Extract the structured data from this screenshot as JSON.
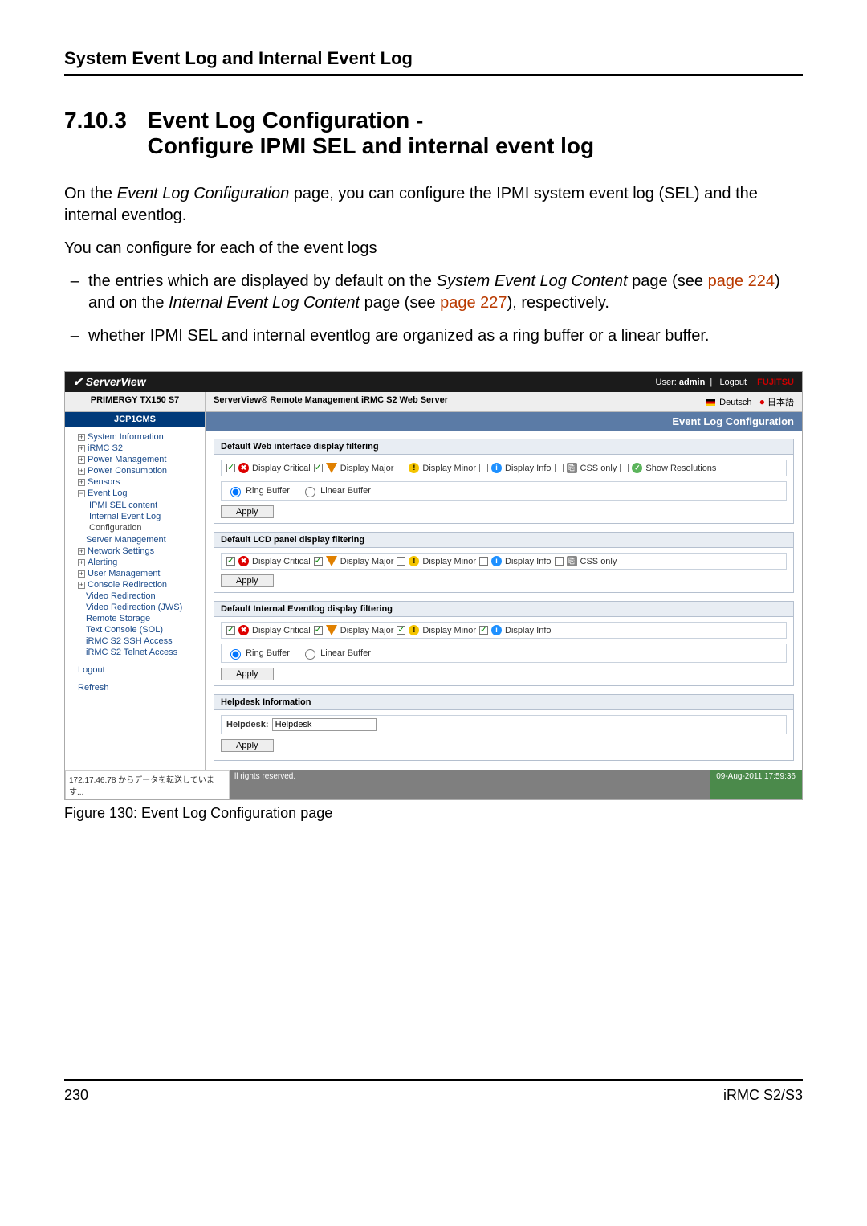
{
  "doc": {
    "section_header": "System Event Log and Internal Event Log",
    "section_number": "7.10.3",
    "section_title_line1": "Event Log Configuration -",
    "section_title_line2": "Configure IPMI SEL and internal event log",
    "para1_pre": "On the ",
    "para1_em": "Event Log Configuration",
    "para1_post": " page, you can configure the IPMI system event log (SEL) and the internal eventlog.",
    "para2": "You can configure for each of the event logs",
    "bullet1_pre": "the entries which are displayed by default on the ",
    "bullet1_em1": "System Event Log Content",
    "bullet1_mid1": " page (see ",
    "bullet1_link1": "page 224",
    "bullet1_mid2": ") and on the ",
    "bullet1_em2": "Internal Event Log Content",
    "bullet1_mid3": " page (see ",
    "bullet1_link2": "page 227",
    "bullet1_post": "), respectively.",
    "bullet2": "whether IPMI SEL and internal eventlog are organized as a ring buffer or a linear buffer.",
    "figure_caption": "Figure 130: Event Log Configuration page",
    "page_number": "230",
    "footer_right": "iRMC S2/S3"
  },
  "sv": {
    "brand": "ServerView",
    "user_label": "User: ",
    "user": "admin",
    "logout": "Logout",
    "fujitsu": "FUJITSU",
    "server_model": "PRIMERGY TX150 S7",
    "subtitle": "ServerView® Remote Management iRMC S2 Web Server",
    "lang_de": "Deutsch",
    "lang_jp": "日本語",
    "node": "JCP1CMS",
    "status_left": "172.17.46.78 からデータを転送しています...",
    "status_mid": "ll rights reserved.",
    "status_right": "09-Aug-2011 17:59:36"
  },
  "tree": {
    "items": [
      "System Information",
      "iRMC S2",
      "Power Management",
      "Power Consumption",
      "Sensors",
      "Event Log",
      "IPMI SEL content",
      "Internal Event Log",
      "Configuration",
      "Server Management",
      "Network Settings",
      "Alerting",
      "User Management",
      "Console Redirection",
      "Video Redirection",
      "Video Redirection (JWS)",
      "Remote Storage",
      "Text Console (SOL)",
      "iRMC S2 SSH Access",
      "iRMC S2 Telnet Access",
      "Logout",
      "Refresh"
    ]
  },
  "content": {
    "title": "Event Log Configuration",
    "panel1": {
      "title": "Default Web interface display filtering",
      "crit": "Display Critical",
      "major": "Display Major",
      "minor": "Display Minor",
      "info": "Display Info",
      "css": "CSS only",
      "resol": "Show Resolutions",
      "ring": "Ring Buffer",
      "linear": "Linear Buffer",
      "apply": "Apply"
    },
    "panel2": {
      "title": "Default LCD panel display filtering",
      "crit": "Display Critical",
      "major": "Display Major",
      "minor": "Display Minor",
      "info": "Display Info",
      "css": "CSS only",
      "apply": "Apply"
    },
    "panel3": {
      "title": "Default Internal Eventlog display filtering",
      "crit": "Display Critical",
      "major": "Display Major",
      "minor": "Display Minor",
      "info": "Display Info",
      "ring": "Ring Buffer",
      "linear": "Linear Buffer",
      "apply": "Apply"
    },
    "panel4": {
      "title": "Helpdesk Information",
      "label": "Helpdesk:",
      "value": "Helpdesk",
      "apply": "Apply"
    }
  }
}
